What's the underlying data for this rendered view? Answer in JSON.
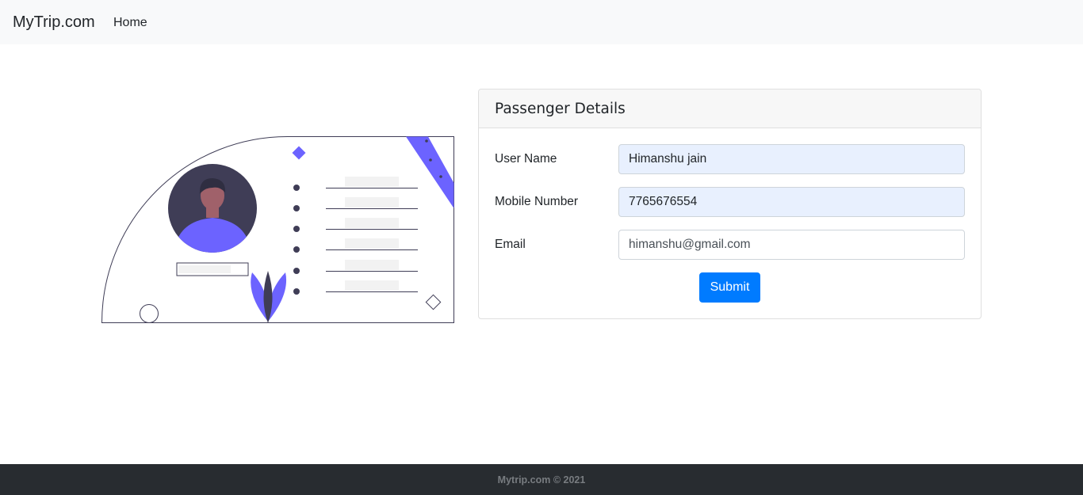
{
  "navbar": {
    "brand": "MyTrip.com",
    "links": [
      {
        "label": "Home"
      }
    ]
  },
  "form": {
    "title": "Passenger Details",
    "fields": [
      {
        "label": "User Name",
        "value": "Himanshu jain"
      },
      {
        "label": "Mobile Number",
        "value": "7765676554"
      },
      {
        "label": "Email",
        "value": "himanshu@gmail.com"
      }
    ],
    "submit_label": "Submit"
  },
  "illustration": {
    "accent_color": "#6c63ff",
    "dark_color": "#3f3d56"
  },
  "footer": {
    "text": "Mytrip.com © 2021"
  }
}
